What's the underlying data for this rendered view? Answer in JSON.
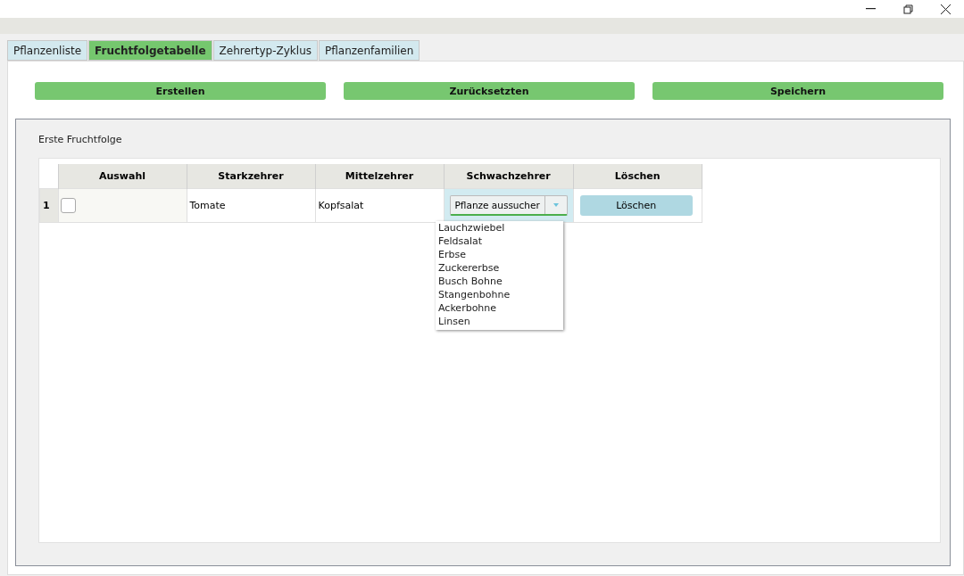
{
  "tabs": [
    {
      "label": "Pflanzenliste",
      "selected": false
    },
    {
      "label": "Fruchtfolgetabelle",
      "selected": true
    },
    {
      "label": "Zehrertyp-Zyklus",
      "selected": false
    },
    {
      "label": "Pflanzenfamilien",
      "selected": false
    }
  ],
  "actions": [
    "Erstellen",
    "Zurücksetzten",
    "Speichern"
  ],
  "group": {
    "title": "Erste Fruchtfolge",
    "table": {
      "columns": [
        "Auswahl",
        "Starkzehrer",
        "Mittelzehrer",
        "Schwachzehrer",
        "Löschen"
      ],
      "rows": [
        {
          "index": "1",
          "checked": false,
          "starkzehrer": "Tomate",
          "mittelzehrer": "Kopfsalat",
          "schwachzehrer": {
            "placeholder": "Pflanze aussucher",
            "expanded": true,
            "options": [
              "Lauchzwiebel",
              "Feldsalat",
              "Erbse",
              "Zuckererbse",
              "Busch Bohne",
              "Stangenbohne",
              "Ackerbohne",
              "Linsen"
            ]
          },
          "delete": "Löschen"
        }
      ]
    }
  }
}
